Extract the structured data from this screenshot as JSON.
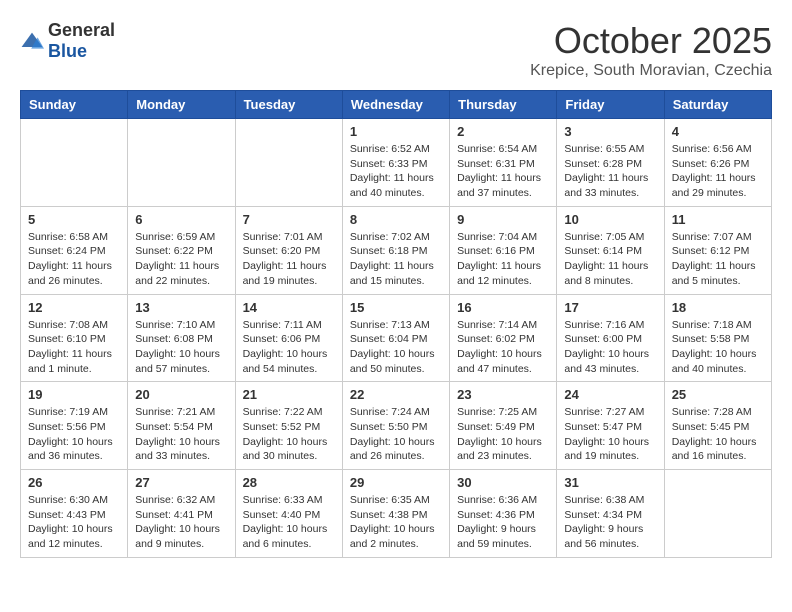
{
  "header": {
    "logo_general": "General",
    "logo_blue": "Blue",
    "month_year": "October 2025",
    "location": "Krepice, South Moravian, Czechia"
  },
  "days_of_week": [
    "Sunday",
    "Monday",
    "Tuesday",
    "Wednesday",
    "Thursday",
    "Friday",
    "Saturday"
  ],
  "weeks": [
    [
      {
        "day": "",
        "info": ""
      },
      {
        "day": "",
        "info": ""
      },
      {
        "day": "",
        "info": ""
      },
      {
        "day": "1",
        "info": "Sunrise: 6:52 AM\nSunset: 6:33 PM\nDaylight: 11 hours\nand 40 minutes."
      },
      {
        "day": "2",
        "info": "Sunrise: 6:54 AM\nSunset: 6:31 PM\nDaylight: 11 hours\nand 37 minutes."
      },
      {
        "day": "3",
        "info": "Sunrise: 6:55 AM\nSunset: 6:28 PM\nDaylight: 11 hours\nand 33 minutes."
      },
      {
        "day": "4",
        "info": "Sunrise: 6:56 AM\nSunset: 6:26 PM\nDaylight: 11 hours\nand 29 minutes."
      }
    ],
    [
      {
        "day": "5",
        "info": "Sunrise: 6:58 AM\nSunset: 6:24 PM\nDaylight: 11 hours\nand 26 minutes."
      },
      {
        "day": "6",
        "info": "Sunrise: 6:59 AM\nSunset: 6:22 PM\nDaylight: 11 hours\nand 22 minutes."
      },
      {
        "day": "7",
        "info": "Sunrise: 7:01 AM\nSunset: 6:20 PM\nDaylight: 11 hours\nand 19 minutes."
      },
      {
        "day": "8",
        "info": "Sunrise: 7:02 AM\nSunset: 6:18 PM\nDaylight: 11 hours\nand 15 minutes."
      },
      {
        "day": "9",
        "info": "Sunrise: 7:04 AM\nSunset: 6:16 PM\nDaylight: 11 hours\nand 12 minutes."
      },
      {
        "day": "10",
        "info": "Sunrise: 7:05 AM\nSunset: 6:14 PM\nDaylight: 11 hours\nand 8 minutes."
      },
      {
        "day": "11",
        "info": "Sunrise: 7:07 AM\nSunset: 6:12 PM\nDaylight: 11 hours\nand 5 minutes."
      }
    ],
    [
      {
        "day": "12",
        "info": "Sunrise: 7:08 AM\nSunset: 6:10 PM\nDaylight: 11 hours\nand 1 minute."
      },
      {
        "day": "13",
        "info": "Sunrise: 7:10 AM\nSunset: 6:08 PM\nDaylight: 10 hours\nand 57 minutes."
      },
      {
        "day": "14",
        "info": "Sunrise: 7:11 AM\nSunset: 6:06 PM\nDaylight: 10 hours\nand 54 minutes."
      },
      {
        "day": "15",
        "info": "Sunrise: 7:13 AM\nSunset: 6:04 PM\nDaylight: 10 hours\nand 50 minutes."
      },
      {
        "day": "16",
        "info": "Sunrise: 7:14 AM\nSunset: 6:02 PM\nDaylight: 10 hours\nand 47 minutes."
      },
      {
        "day": "17",
        "info": "Sunrise: 7:16 AM\nSunset: 6:00 PM\nDaylight: 10 hours\nand 43 minutes."
      },
      {
        "day": "18",
        "info": "Sunrise: 7:18 AM\nSunset: 5:58 PM\nDaylight: 10 hours\nand 40 minutes."
      }
    ],
    [
      {
        "day": "19",
        "info": "Sunrise: 7:19 AM\nSunset: 5:56 PM\nDaylight: 10 hours\nand 36 minutes."
      },
      {
        "day": "20",
        "info": "Sunrise: 7:21 AM\nSunset: 5:54 PM\nDaylight: 10 hours\nand 33 minutes."
      },
      {
        "day": "21",
        "info": "Sunrise: 7:22 AM\nSunset: 5:52 PM\nDaylight: 10 hours\nand 30 minutes."
      },
      {
        "day": "22",
        "info": "Sunrise: 7:24 AM\nSunset: 5:50 PM\nDaylight: 10 hours\nand 26 minutes."
      },
      {
        "day": "23",
        "info": "Sunrise: 7:25 AM\nSunset: 5:49 PM\nDaylight: 10 hours\nand 23 minutes."
      },
      {
        "day": "24",
        "info": "Sunrise: 7:27 AM\nSunset: 5:47 PM\nDaylight: 10 hours\nand 19 minutes."
      },
      {
        "day": "25",
        "info": "Sunrise: 7:28 AM\nSunset: 5:45 PM\nDaylight: 10 hours\nand 16 minutes."
      }
    ],
    [
      {
        "day": "26",
        "info": "Sunrise: 6:30 AM\nSunset: 4:43 PM\nDaylight: 10 hours\nand 12 minutes."
      },
      {
        "day": "27",
        "info": "Sunrise: 6:32 AM\nSunset: 4:41 PM\nDaylight: 10 hours\nand 9 minutes."
      },
      {
        "day": "28",
        "info": "Sunrise: 6:33 AM\nSunset: 4:40 PM\nDaylight: 10 hours\nand 6 minutes."
      },
      {
        "day": "29",
        "info": "Sunrise: 6:35 AM\nSunset: 4:38 PM\nDaylight: 10 hours\nand 2 minutes."
      },
      {
        "day": "30",
        "info": "Sunrise: 6:36 AM\nSunset: 4:36 PM\nDaylight: 9 hours\nand 59 minutes."
      },
      {
        "day": "31",
        "info": "Sunrise: 6:38 AM\nSunset: 4:34 PM\nDaylight: 9 hours\nand 56 minutes."
      },
      {
        "day": "",
        "info": ""
      }
    ]
  ]
}
